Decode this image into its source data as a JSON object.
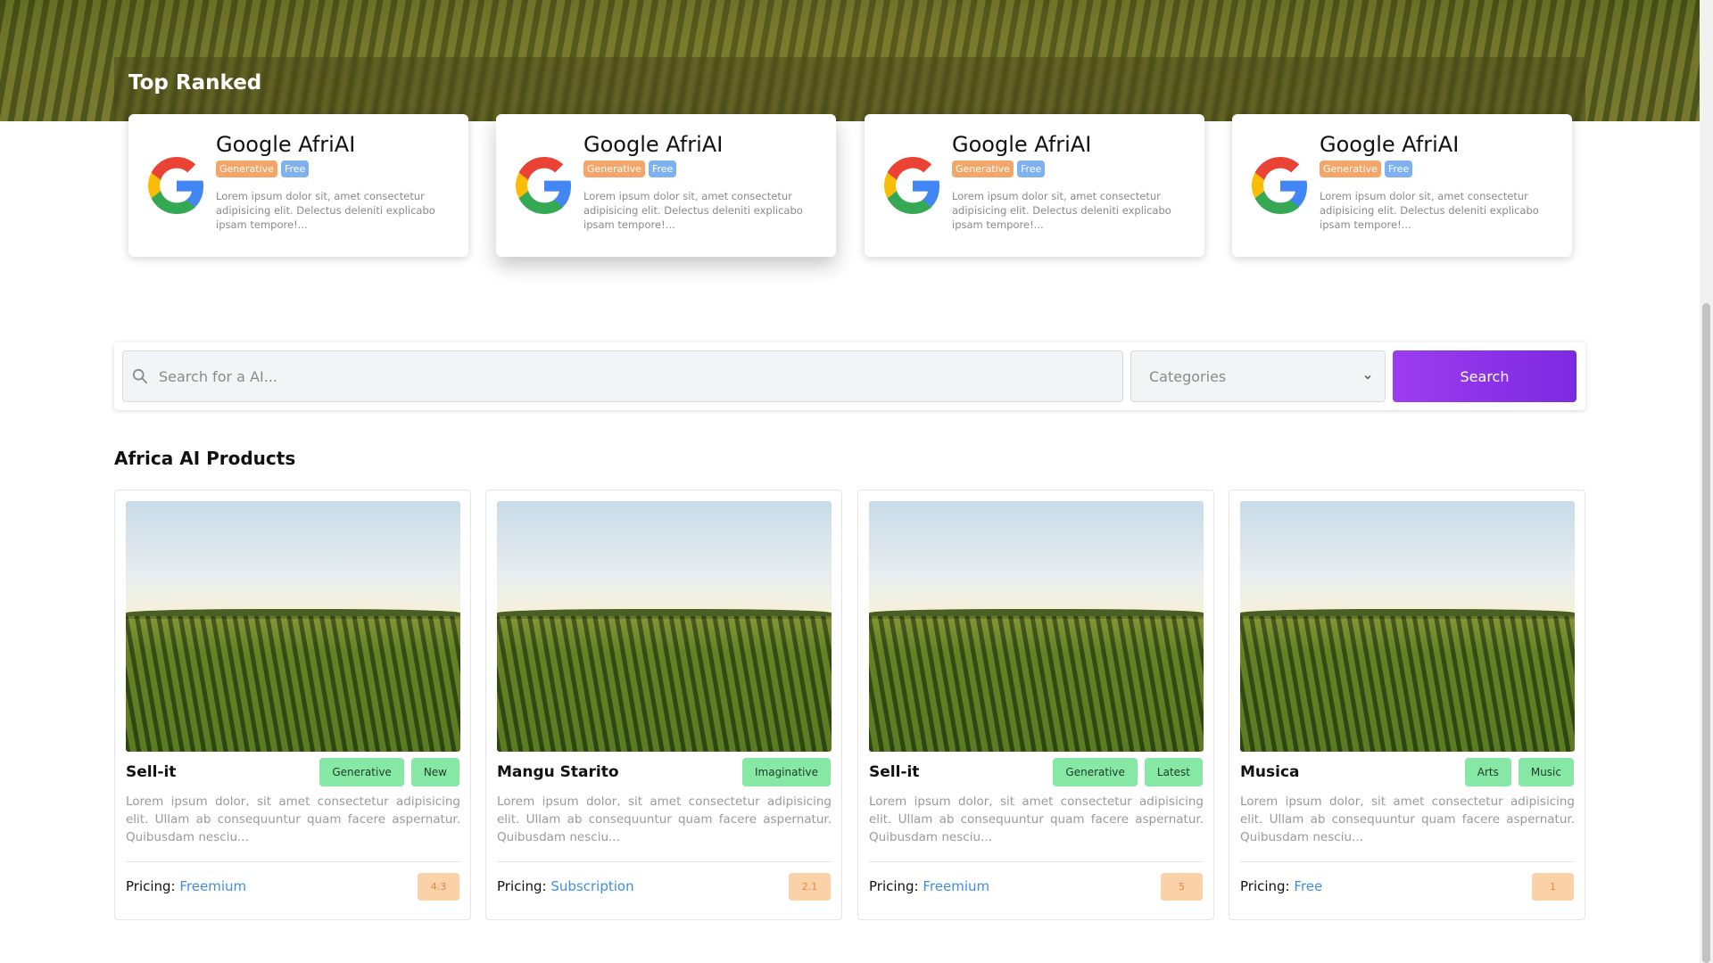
{
  "top_ranked": {
    "title": "Top Ranked",
    "cards": [
      {
        "name": "Google AfriAI",
        "tags": [
          "Generative",
          "Free"
        ],
        "desc": "Lorem ipsum dolor sit, amet consectetur adipisicing elit. Delectus deleniti explicabo ipsam tempore!..."
      },
      {
        "name": "Google AfriAI",
        "tags": [
          "Generative",
          "Free"
        ],
        "desc": "Lorem ipsum dolor sit, amet consectetur adipisicing elit. Delectus deleniti explicabo ipsam tempore!..."
      },
      {
        "name": "Google AfriAI",
        "tags": [
          "Generative",
          "Free"
        ],
        "desc": "Lorem ipsum dolor sit, amet consectetur adipisicing elit. Delectus deleniti explicabo ipsam tempore!..."
      },
      {
        "name": "Google AfriAI",
        "tags": [
          "Generative",
          "Free"
        ],
        "desc": "Lorem ipsum dolor sit, amet consectetur adipisicing elit. Delectus deleniti explicabo ipsam tempore!..."
      }
    ]
  },
  "search": {
    "placeholder": "Search for a AI...",
    "category_label": "Categories",
    "button_label": "Search"
  },
  "products": {
    "title": "Africa AI Products",
    "pricing_label": "Pricing:",
    "items": [
      {
        "name": "Sell-it",
        "tags": [
          "Generative",
          "New"
        ],
        "desc": "Lorem ipsum dolor, sit amet consectetur adipisicing elit. Ullam ab consequuntur quam facere aspernatur. Quibusdam nesciu...",
        "pricing": "Freemium",
        "rating": "4.3"
      },
      {
        "name": "Mangu Starito",
        "tags": [
          "Imaginative"
        ],
        "desc": "Lorem ipsum dolor, sit amet consectetur adipisicing elit. Ullam ab consequuntur quam facere aspernatur. Quibusdam nesciu...",
        "pricing": "Subscription",
        "rating": "2.1"
      },
      {
        "name": "Sell-it",
        "tags": [
          "Generative",
          "Latest"
        ],
        "desc": "Lorem ipsum dolor, sit amet consectetur adipisicing elit. Ullam ab consequuntur quam facere aspernatur. Quibusdam nesciu...",
        "pricing": "Freemium",
        "rating": "5"
      },
      {
        "name": "Musica",
        "tags": [
          "Arts",
          "Music"
        ],
        "desc": "Lorem ipsum dolor, sit amet consectetur adipisicing elit. Ullam ab consequuntur quam facere aspernatur. Quibusdam nesciu...",
        "pricing": "Free",
        "rating": "1"
      }
    ]
  },
  "colors": {
    "accent": "#9d3cf0",
    "tag_green": "#87e8a6",
    "tag_orange": "#f4a66a",
    "tag_blue": "#7fb0ef",
    "link_blue": "#3f8fe0"
  }
}
